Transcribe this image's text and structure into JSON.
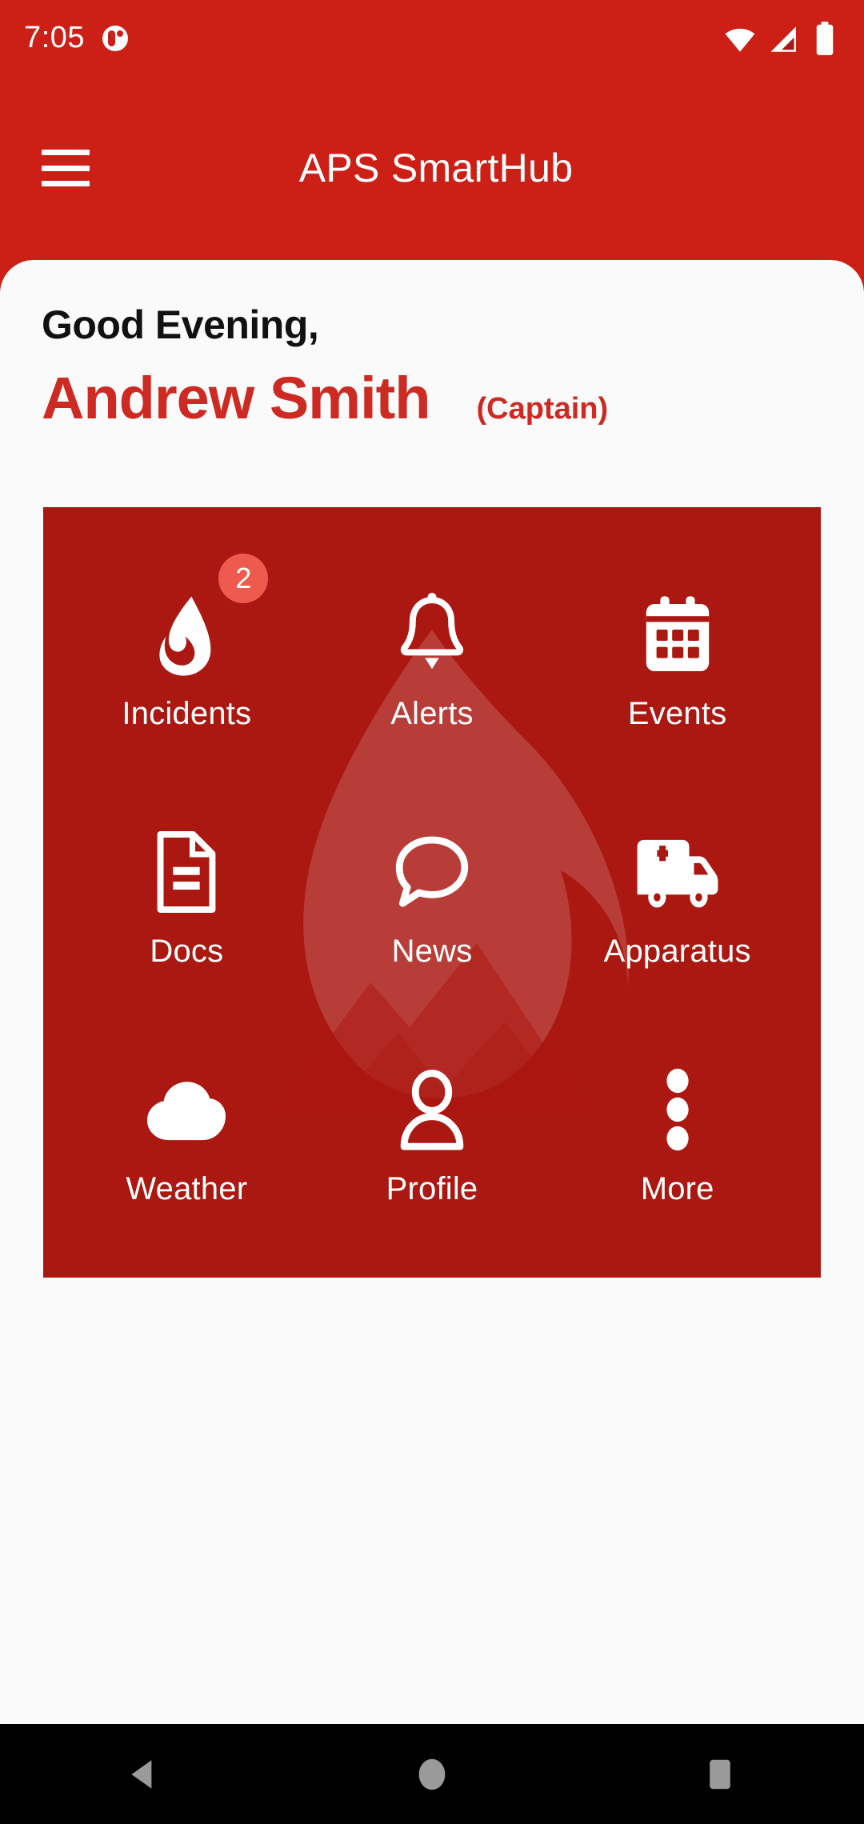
{
  "status_bar": {
    "clock": "7:05",
    "app_notification_icon": "app-dot-icon",
    "wifi_icon": "wifi-icon",
    "signal_icon": "cellular-signal-icon",
    "battery_icon": "battery-icon"
  },
  "app_bar": {
    "menu_icon": "hamburger-menu-icon",
    "title": "APS SmartHub"
  },
  "greeting": {
    "salutation": "Good Evening,",
    "user_name": "Andrew Smith",
    "user_rank": "(Captain)"
  },
  "grid": {
    "items": [
      {
        "label": "Incidents",
        "icon": "flame-icon",
        "badge": "2"
      },
      {
        "label": "Alerts",
        "icon": "bell-icon",
        "badge": ""
      },
      {
        "label": "Events",
        "icon": "calendar-icon",
        "badge": ""
      },
      {
        "label": "Docs",
        "icon": "document-icon",
        "badge": ""
      },
      {
        "label": "News",
        "icon": "chat-bubble-icon",
        "badge": ""
      },
      {
        "label": "Apparatus",
        "icon": "ambulance-icon",
        "badge": ""
      },
      {
        "label": "Weather",
        "icon": "cloud-icon",
        "badge": ""
      },
      {
        "label": "Profile",
        "icon": "person-icon",
        "badge": ""
      },
      {
        "label": "More",
        "icon": "more-vertical-icon",
        "badge": ""
      }
    ],
    "watermark_icon": "flame-mountain-watermark"
  },
  "nav_bar": {
    "back_icon": "back-triangle-icon",
    "home_icon": "home-circle-icon",
    "recents_icon": "recents-square-icon"
  },
  "colors": {
    "brand_red": "#CC2017",
    "panel_red": "#AB1811",
    "name_red": "#CC2A22",
    "badge_red": "#EF5A4F",
    "sheet_bg": "#FAFAFA",
    "nav_bg": "#000000"
  }
}
